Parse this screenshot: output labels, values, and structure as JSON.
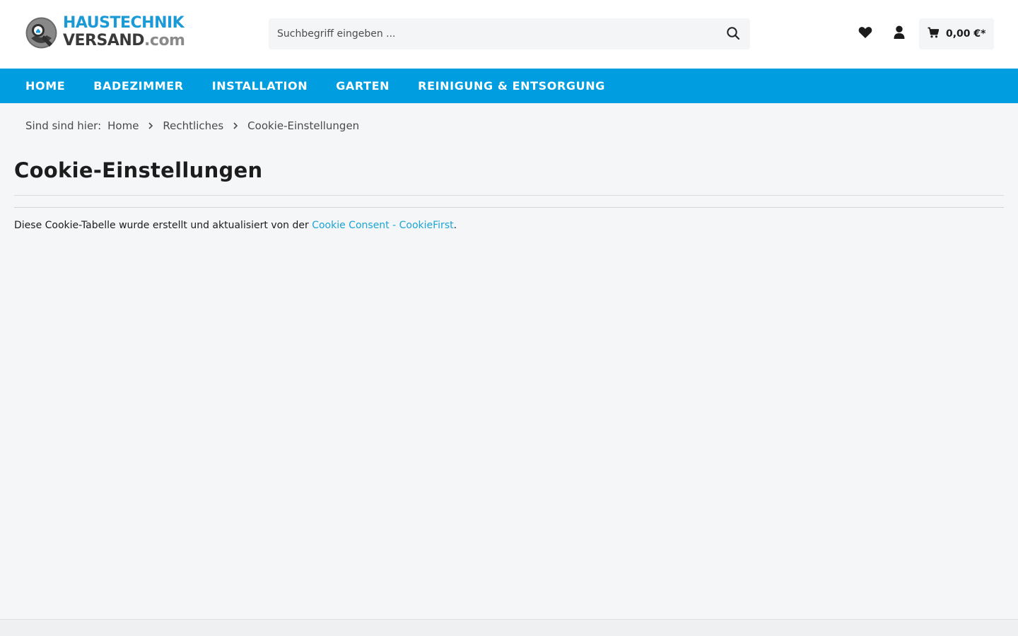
{
  "brand": {
    "line1": "HAUSTECHNIK",
    "line2_main": "VERSAND",
    "line2_suffix": ".com",
    "colors": {
      "blue": "#1b9ad6",
      "dark": "#3a3a3a",
      "grey": "#8a8a8a"
    }
  },
  "search": {
    "placeholder": "Suchbegriff eingeben ...",
    "value": "",
    "icon": "search-icon"
  },
  "header_actions": {
    "wishlist_icon": "heart-icon",
    "account_icon": "user-icon",
    "cart_icon": "cart-icon",
    "cart_amount": "0,00 €*"
  },
  "nav": {
    "background": "#009de0",
    "items": [
      {
        "label": "HOME"
      },
      {
        "label": "BADEZIMMER"
      },
      {
        "label": "INSTALLATION"
      },
      {
        "label": "GARTEN"
      },
      {
        "label": "REINIGUNG & ENTSORGUNG"
      }
    ]
  },
  "breadcrumb": {
    "prefix": "Sind sind hier:",
    "items": [
      {
        "label": "Home"
      },
      {
        "label": "Rechtliches"
      },
      {
        "label": "Cookie-Einstellungen"
      }
    ]
  },
  "page": {
    "title": "Cookie-Einstellungen",
    "info_text": "Diese Cookie-Tabelle wurde erstellt und aktualisiert von der ",
    "info_link": "Cookie Consent - CookieFirst",
    "info_suffix": ".",
    "link_color": "#1aa5d6"
  }
}
